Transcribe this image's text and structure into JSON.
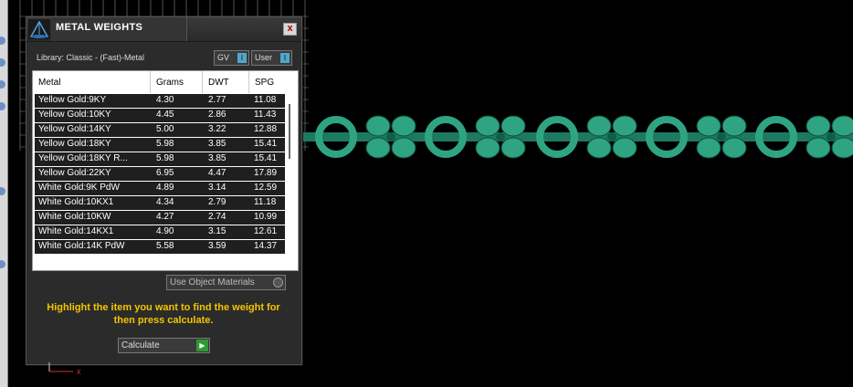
{
  "panel": {
    "title": "METAL WEIGHTS",
    "close_label": "x",
    "library_label": "Library: Classic - (Fast)-Metal",
    "toggles": [
      {
        "label": "GV",
        "knob": "I"
      },
      {
        "label": "User",
        "knob": "I"
      }
    ],
    "table": {
      "columns": [
        "Metal",
        "Grams",
        "DWT",
        "SPG"
      ],
      "rows": [
        [
          "Yellow Gold:9KY",
          "4.30",
          "2.77",
          "11.08"
        ],
        [
          "Yellow Gold:10KY",
          "4.45",
          "2.86",
          "11.43"
        ],
        [
          "Yellow Gold:14KY",
          "5.00",
          "3.22",
          "12.88"
        ],
        [
          "Yellow Gold:18KY",
          "5.98",
          "3.85",
          "15.41"
        ],
        [
          "Yellow Gold:18KY R...",
          "5.98",
          "3.85",
          "15.41"
        ],
        [
          "Yellow Gold:22KY",
          "6.95",
          "4.47",
          "17.89"
        ],
        [
          "White Gold:9K PdW",
          "4.89",
          "3.14",
          "12.59"
        ],
        [
          "White Gold:10KX1",
          "4.34",
          "2.79",
          "11.18"
        ],
        [
          "White Gold:10KW",
          "4.27",
          "2.74",
          "10.99"
        ],
        [
          "White Gold:14KX1",
          "4.90",
          "3.15",
          "12.61"
        ],
        [
          "White Gold:14K PdW",
          "5.58",
          "3.59",
          "14.37"
        ]
      ]
    },
    "use_object_materials_label": "Use Object Materials",
    "instructions": "Highlight the item you want to find the weight for then press calculate.",
    "calculate_label": "Calculate"
  },
  "colors": {
    "panel_bg": "#2b2b2b",
    "instruction_text": "#f2c500",
    "chain": "#2fa483",
    "accent_knob": "#4fa8c8",
    "go_button": "#2e9a32"
  },
  "icons": [
    "scale-logo-icon",
    "close-icon",
    "play-arrow-icon",
    "axis-gizmo-icon"
  ]
}
